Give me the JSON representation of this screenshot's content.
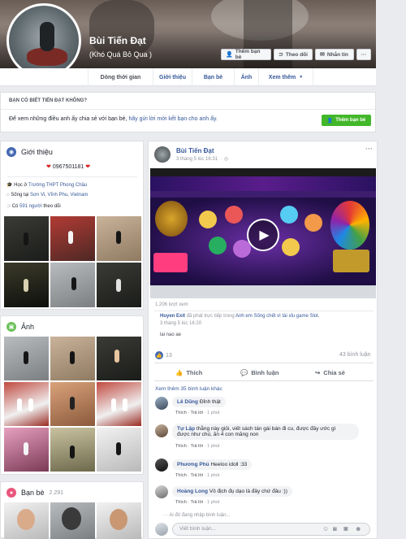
{
  "profile": {
    "name": "Bùi Tiến Đạt",
    "nickname": "(Khó Quá Bỏ Qua )",
    "buttons": {
      "add_friend": "Thêm bạn bè",
      "follow": "Theo dõi",
      "message": "Nhắn tin",
      "more": "···"
    }
  },
  "tabs": [
    "Dòng thời gian",
    "Giới thiệu",
    "Bạn bè",
    "Ảnh",
    "Xem thêm"
  ],
  "know": {
    "title": "BẠN CÓ BIẾT TIẾN ĐẠT KHÔNG?",
    "text_prefix": "Để xem những điều anh ấy chia sẻ với bạn bè,",
    "link": "hãy gửi lời mời kết bạn cho anh ấy.",
    "button": "Thêm bạn bè"
  },
  "intro": {
    "title": "Giới thiệu",
    "bio": "0967501181",
    "items": [
      {
        "icon": "graduation-cap-icon",
        "prefix": "Học ở",
        "link": "Trường THPT Phong Châu"
      },
      {
        "icon": "home-icon",
        "prefix": "Sống tại",
        "link": "Sơn Vi, Vĩnh Phu, Vietnam"
      },
      {
        "icon": "rss-icon",
        "prefix": "Có",
        "link": "591 người",
        "suffix": "theo dõi"
      }
    ]
  },
  "photos": {
    "title": "Ảnh"
  },
  "friends": {
    "title": "Bạn bè",
    "count": "2.291"
  },
  "post": {
    "author": "Bùi Tiến Đạt",
    "time": "3 tháng 5 lúc 16:31",
    "views": "1.206 lượt xem",
    "shared_user": "Huyen Exit",
    "shared_text": "đã phát trực tiếp trong",
    "shared_group": "Anh em Sống chết vì tài xỉu game Slot.",
    "shared_time": "3 tháng 5 lúc 16:20",
    "caption": "lai nao ae",
    "reactions": "13",
    "comments_count": "43 bình luận",
    "actions": {
      "like": "Thích",
      "comment": "Bình luận",
      "share": "Chia sẻ"
    },
    "more_comments": "Xem thêm 35 bình luận khác",
    "comments": [
      {
        "name": "Lê Dũng",
        "text": "Đỉnh thật",
        "meta": [
          "Thích",
          "Trả lời",
          "1 phút"
        ]
      },
      {
        "name": "Tự Lập",
        "text": "thằng này giỏi, viết sách tán gái bán đi cu, được đầy ước gì",
        "text2": "được như chú, ăn 4 con măng non",
        "meta": [
          "Thích",
          "Trả lời",
          "1 phút"
        ]
      },
      {
        "name": "Phương Phú",
        "text": "Heeloo idoll :33",
        "meta": [
          "Thích",
          "Trả lời",
          "1 phút"
        ]
      },
      {
        "name": "Hoàng Long",
        "text": "Vô địch đụ dạo là đây chứ đâu :))",
        "meta": [
          "Thích",
          "Trả lời",
          "1 phút"
        ]
      }
    ],
    "typing": "Ai đó đang nhập bình luận...",
    "comment_placeholder": "Viết bình luận..."
  },
  "colors": {
    "link": "#365899",
    "green": "#42b72a",
    "bg": "#e9ebee"
  }
}
